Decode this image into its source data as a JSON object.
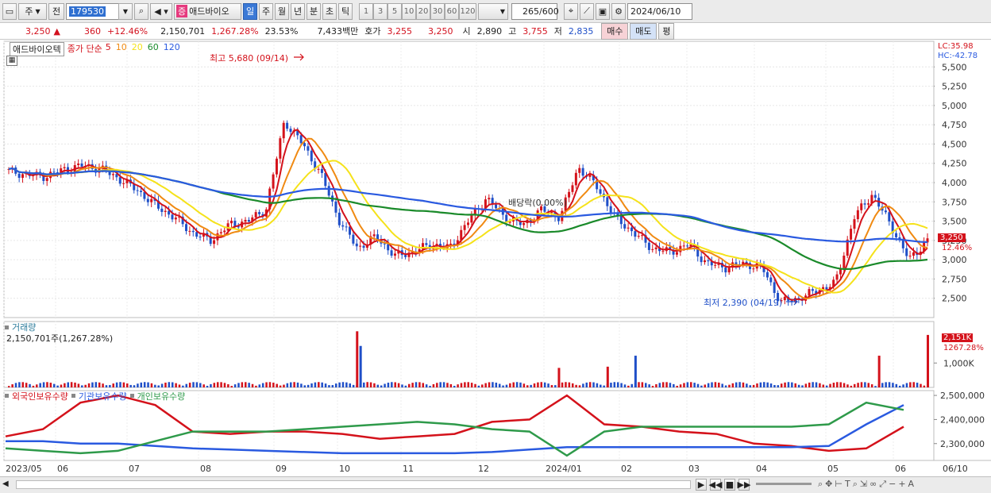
{
  "toolbar": {
    "market_label": "주",
    "prev_label": "전",
    "code_value": "179530",
    "stock_badge": "증",
    "stock_name": "애드바이오",
    "period_buttons": [
      "일",
      "주",
      "월",
      "년",
      "분",
      "초",
      "틱"
    ],
    "interval_buttons": [
      "1",
      "3",
      "5",
      "10",
      "20",
      "30",
      "60",
      "120"
    ],
    "count_value": "265",
    "count_max": "/600",
    "date_value": "2024/06/10"
  },
  "quote": {
    "price": "3,250",
    "arrow": "▲",
    "change": "360",
    "change_pct": "+12.46%",
    "volume": "2,150,701",
    "volume_ratio": "1,267.28%",
    "turnover": "23.53%",
    "trade_value": "7,433백만",
    "ask_label": "호가",
    "ask": "3,255",
    "bid": "3,250",
    "open_label": "시",
    "open": "2,890",
    "high_label": "고",
    "high": "3,755",
    "low_label": "저",
    "low": "2,835",
    "buy_button": "매수",
    "sell_button": "매도",
    "eval_button": "평"
  },
  "price_panel": {
    "stock_tag": "애드바이오텍",
    "legend_title": "종가 단순",
    "ma_periods": [
      "5",
      "10",
      "20",
      "60",
      "120"
    ],
    "ma_colors": [
      "#d4121b",
      "#f08a12",
      "#f5e21a",
      "#1a8a2a",
      "#2a5ae0"
    ],
    "lc_label": "LC:35.98",
    "hc_label": "HC:-42.78",
    "high_annotation": "최고 5,680 (09/14)",
    "low_annotation": "최저 2,390 (04/19)",
    "dividend_annotation": "배당락(0.00%)",
    "last_price_tag": "3,250",
    "last_pct_tag": "12.46%"
  },
  "volume_panel": {
    "title": "거래량",
    "value_text": "2,150,701주(1,267.28%)",
    "tag_value": "2,151K",
    "tag_pct": "1267.28%"
  },
  "holdings_panel": {
    "legend": [
      "외국인보유수량",
      "기관보유수량",
      "개인보유수량"
    ],
    "legend_colors": [
      "#d4121b",
      "#2a5ae0",
      "#2e9a4a"
    ]
  },
  "x_axis": [
    "2023/05",
    "06",
    "07",
    "08",
    "09",
    "10",
    "11",
    "12",
    "2024/01",
    "02",
    "03",
    "04",
    "05",
    "06",
    "06/10"
  ],
  "chart_data": {
    "type": "candlestick",
    "price_axis_ticks": [
      "5,500",
      "5,250",
      "5,000",
      "4,750",
      "4,500",
      "4,250",
      "4,000",
      "3,750",
      "3,500",
      "3,250",
      "3,000",
      "2,750",
      "2,500"
    ],
    "price_range": [
      2250,
      5750
    ],
    "volume_axis_ticks": [
      "1,000K"
    ],
    "volume_range": [
      0,
      2700000
    ],
    "holdings_axis_ticks": [
      "2,500,000",
      "2,400,000",
      "2,300,000"
    ],
    "holdings_range": [
      2230000,
      2520000
    ],
    "price_points": [
      {
        "d": "2023/05/02",
        "c": 4150
      },
      {
        "d": "05/10",
        "c": 4100
      },
      {
        "d": "05/19",
        "c": 4080
      },
      {
        "d": "05/31",
        "c": 4170
      },
      {
        "d": "06/12",
        "c": 4220
      },
      {
        "d": "06/22",
        "c": 4180
      },
      {
        "d": "07/03",
        "c": 4050
      },
      {
        "d": "07/12",
        "c": 3900
      },
      {
        "d": "07/21",
        "c": 3700
      },
      {
        "d": "07/31",
        "c": 3550
      },
      {
        "d": "08/09",
        "c": 3350
      },
      {
        "d": "08/16",
        "c": 3250
      },
      {
        "d": "08/24",
        "c": 3450
      },
      {
        "d": "09/04",
        "c": 3500
      },
      {
        "d": "09/11",
        "c": 3650
      },
      {
        "d": "09/14",
        "c": 4800
      },
      {
        "d": "09/20",
        "c": 4500
      },
      {
        "d": "09/27",
        "c": 4100
      },
      {
        "d": "10/06",
        "c": 3500
      },
      {
        "d": "10/12",
        "c": 3150
      },
      {
        "d": "10/20",
        "c": 3300
      },
      {
        "d": "10/30",
        "c": 3050
      },
      {
        "d": "11/08",
        "c": 3100
      },
      {
        "d": "11/17",
        "c": 3200
      },
      {
        "d": "11/24",
        "c": 3150
      },
      {
        "d": "11/29",
        "c": 3500
      },
      {
        "d": "12/05",
        "c": 3800
      },
      {
        "d": "12/13",
        "c": 3550
      },
      {
        "d": "12/21",
        "c": 3450
      },
      {
        "d": "12/28",
        "c": 3650
      },
      {
        "d": "2024/01/03",
        "c": 3550
      },
      {
        "d": "01/09",
        "c": 4200
      },
      {
        "d": "01/16",
        "c": 3950
      },
      {
        "d": "01/24",
        "c": 3550
      },
      {
        "d": "02/01",
        "c": 3350
      },
      {
        "d": "02/13",
        "c": 3150
      },
      {
        "d": "02/22",
        "c": 3100
      },
      {
        "d": "03/04",
        "c": 3200
      },
      {
        "d": "03/13",
        "c": 2950
      },
      {
        "d": "03/21",
        "c": 2900
      },
      {
        "d": "04/01",
        "c": 2950
      },
      {
        "d": "04/10",
        "c": 2900
      },
      {
        "d": "04/19",
        "c": 2450
      },
      {
        "d": "04/30",
        "c": 2500
      },
      {
        "d": "05/09",
        "c": 2600
      },
      {
        "d": "05/17",
        "c": 2700
      },
      {
        "d": "05/23",
        "c": 3550
      },
      {
        "d": "05/27",
        "c": 3850
      },
      {
        "d": "05/31",
        "c": 3450
      },
      {
        "d": "06/05",
        "c": 3000
      },
      {
        "d": "06/10",
        "c": 3250
      }
    ],
    "volume_spikes": [
      {
        "d": "09/14",
        "v": 2300000
      },
      {
        "d": "09/15",
        "v": 1700000
      },
      {
        "d": "12/05",
        "v": 800000
      },
      {
        "d": "12/28",
        "v": 850000
      },
      {
        "d": "2024/01/09",
        "v": 1300000
      },
      {
        "d": "05/27",
        "v": 1300000
      },
      {
        "d": "06/10",
        "v": 2150701
      }
    ],
    "holdings_series": [
      {
        "name": "외국인보유수량",
        "values": [
          2330000,
          2360000,
          2470000,
          2500000,
          2460000,
          2350000,
          2340000,
          2350000,
          2350000,
          2340000,
          2320000,
          2330000,
          2340000,
          2390000,
          2400000,
          2500000,
          2380000,
          2370000,
          2350000,
          2340000,
          2300000,
          2290000,
          2270000,
          2280000,
          2370000
        ]
      },
      {
        "name": "기관보유수량",
        "values": [
          2310000,
          2310000,
          2300000,
          2300000,
          2290000,
          2280000,
          2275000,
          2270000,
          2265000,
          2260000,
          2260000,
          2260000,
          2260000,
          2265000,
          2275000,
          2285000,
          2285000,
          2285000,
          2285000,
          2285000,
          2285000,
          2285000,
          2290000,
          2380000,
          2460000
        ]
      },
      {
        "name": "개인보유수량",
        "values": [
          2280000,
          2270000,
          2260000,
          2270000,
          2310000,
          2350000,
          2350000,
          2350000,
          2360000,
          2370000,
          2380000,
          2390000,
          2380000,
          2360000,
          2350000,
          2250000,
          2350000,
          2370000,
          2370000,
          2370000,
          2370000,
          2370000,
          2380000,
          2470000,
          2440000
        ]
      }
    ]
  }
}
